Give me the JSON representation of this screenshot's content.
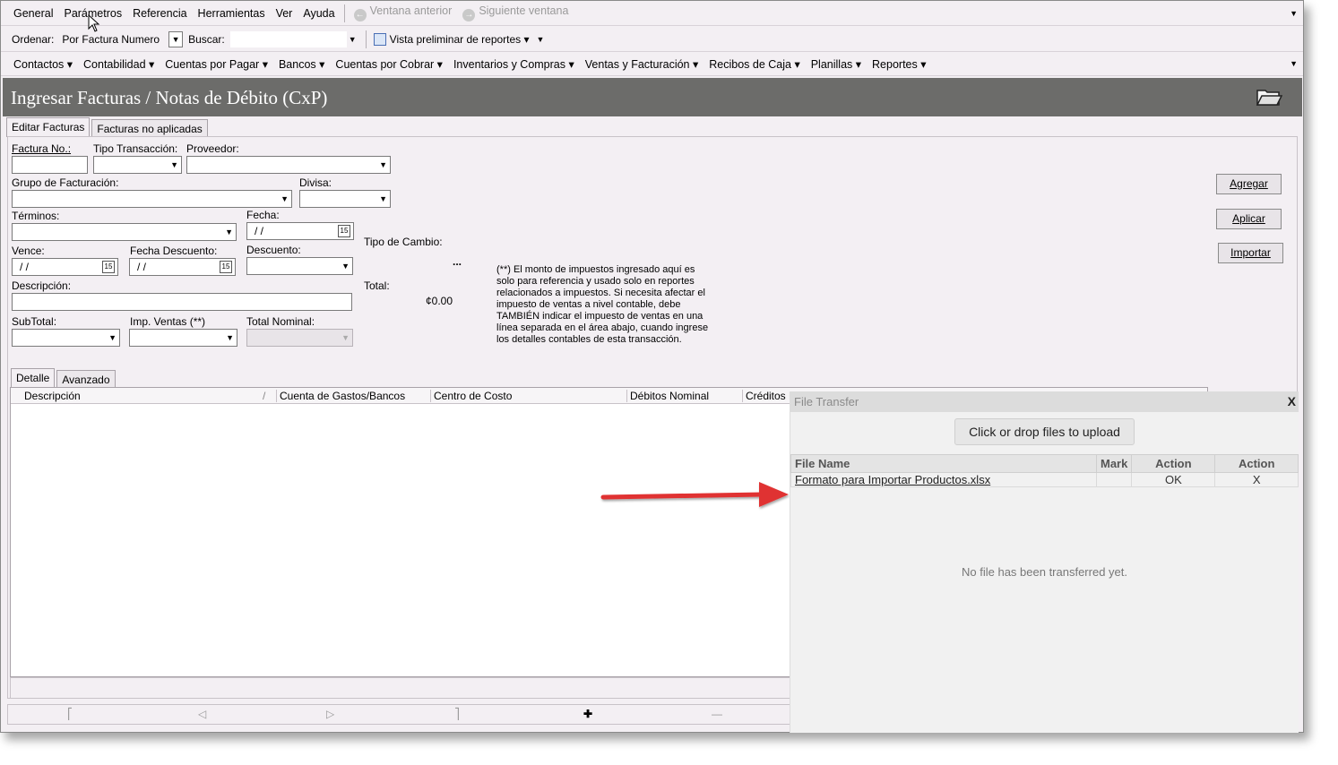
{
  "menubar": {
    "items": [
      "General",
      "Parámetros",
      "Referencia",
      "Herramientas",
      "Ver",
      "Ayuda"
    ],
    "prev_window": "Ventana anterior",
    "next_window": "Siguiente ventana"
  },
  "toolbar": {
    "sort_label": "Ordenar:",
    "sort_value": "Por Factura Numero",
    "search_label": "Buscar:",
    "preview_label": "Vista preliminar de reportes"
  },
  "modules": [
    "Contactos",
    "Contabilidad",
    "Cuentas por Pagar",
    "Bancos",
    "Cuentas por Cobrar",
    "Inventarios y Compras",
    "Ventas y Facturación",
    "Recibos de Caja",
    "Planillas",
    "Reportes"
  ],
  "page": {
    "title": "Ingresar Facturas / Notas de Débito (CxP)",
    "tabs": [
      "Editar Facturas",
      "Facturas no aplicadas"
    ]
  },
  "form": {
    "factura_no": "Factura No.:",
    "tipo_transaccion": "Tipo Transacción:",
    "proveedor": "Proveedor:",
    "grupo_facturacion": "Grupo de Facturación:",
    "divisa": "Divisa:",
    "terminos": "Términos:",
    "fecha": "Fecha:",
    "vence": "Vence:",
    "fecha_descuento": "Fecha Descuento:",
    "descuento": "Descuento:",
    "descripcion": "Descripción:",
    "subtotal": "SubTotal:",
    "imp_ventas": "Imp. Ventas (**)",
    "total_nominal": "Total Nominal:",
    "tipo_cambio": "Tipo de Cambio:",
    "ellipsis": "...",
    "total": "Total:",
    "total_value": "¢0.00",
    "empty_date": "/ /",
    "calendar_glyph": "15",
    "note": "(**) El monto de impuestos ingresado aquí es solo para referencia y usado solo en reportes relacionados a impuestos. Si necesita afectar el impuesto de ventas a nivel contable, debe TAMBIÉN indicar el impuesto de ventas en una línea separada en el área abajo, cuando ingrese los detalles contables de esta transacción."
  },
  "buttons": {
    "agregar": "Agregar",
    "aplicar": "Aplicar",
    "importar": "Importar"
  },
  "detail": {
    "tabs": [
      "Detalle",
      "Avanzado"
    ],
    "columns": [
      "Descripción",
      "Cuenta de Gastos/Bancos",
      "Centro de Costo",
      "Débitos Nominal",
      "Créditos N"
    ],
    "sort_glyph": "/"
  },
  "file_transfer": {
    "title": "File Transfer",
    "close": "X",
    "upload_label": "Click or drop files to upload",
    "columns": [
      "File Name",
      "Mark",
      "Action",
      "Action"
    ],
    "rows": [
      {
        "file_name": "Formato para Importar Productos.xlsx",
        "mark": "",
        "action1": "OK",
        "action2": "X"
      }
    ],
    "empty_message": "No file has been transferred yet."
  },
  "colors": {
    "title_band": "#6c6c6a",
    "window_bg": "#f3eff3",
    "arrow": "#e03030"
  }
}
